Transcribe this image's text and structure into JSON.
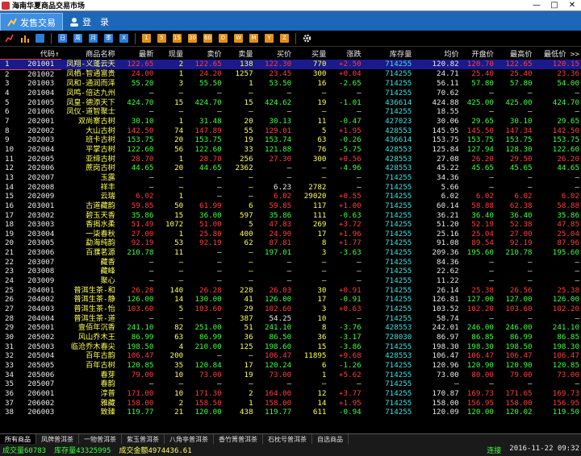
{
  "window": {
    "title": "海南华夏商品交易市场",
    "min": "—",
    "max": "□",
    "close": "✕"
  },
  "tabs": [
    {
      "label": "发售交易"
    },
    {
      "label": "登　录"
    }
  ],
  "toolbar": {
    "icons": [
      "line-chart-icon",
      "bar-chart-icon",
      "display-icon",
      "F1",
      "F2",
      "F3",
      "F4",
      "F5",
      "F6",
      "F7",
      "F8",
      "F9",
      "F10",
      "F11",
      "F12",
      "F13",
      "F14",
      "F15",
      "gear-icon"
    ]
  },
  "columns": [
    "",
    "代码↑",
    "商品名称",
    "最新",
    "现量",
    "卖价",
    "卖量",
    "买价",
    "买量",
    "涨跌",
    "库存量",
    "均价",
    "开盘价",
    "最高价",
    "最低价 >>"
  ],
  "rows": [
    [
      "1",
      "201001",
      "凤翔-义蓬云天",
      "122.65",
      "2",
      "122.65",
      "138",
      "122.30",
      "770",
      "+2.50",
      "714255",
      "120.82",
      "120.70",
      "122.65",
      "120.15"
    ],
    [
      "2",
      "201002",
      "凤栖-智通富贵",
      "24.00",
      "1",
      "24.20",
      "1257",
      "23.45",
      "300",
      "+0.04",
      "714255",
      "24.71",
      "25.40",
      "25.40",
      "23.36"
    ],
    [
      "3",
      "201003",
      "凤和-通润而泽",
      "55.20",
      "3",
      "55.50",
      "1",
      "53.50",
      "16",
      "-2.65",
      "714255",
      "56.11",
      "57.80",
      "57.80",
      "54.00"
    ],
    [
      "4",
      "201004",
      "凤鸣-倍达九州",
      "—",
      "—",
      "—",
      "—",
      "—",
      "—",
      "—",
      "714255",
      "70.62",
      "—",
      "—",
      "—"
    ],
    [
      "5",
      "201005",
      "凤皇-德添天下",
      "424.70",
      "15",
      "424.70",
      "15",
      "424.62",
      "19",
      "-1.01",
      "436614",
      "424.88",
      "425.00",
      "425.00",
      "424.70"
    ],
    [
      "6",
      "201006",
      "凤仪-道智聚士",
      "—",
      "—",
      "—",
      "—",
      "—",
      "—",
      "—",
      "714255",
      "18.55",
      "—",
      "—",
      "—"
    ],
    [
      "7",
      "202001",
      "双尚寨古树",
      "30.10",
      "1",
      "31.48",
      "20",
      "30.13",
      "11",
      "-0.47",
      "427023",
      "30.06",
      "29.65",
      "30.10",
      "29.65"
    ],
    [
      "8",
      "202002",
      "大山古树",
      "142.50",
      "74",
      "147.89",
      "55",
      "129.01",
      "5",
      "+1.95",
      "428553",
      "145.95",
      "145.50",
      "147.34",
      "142.50"
    ],
    [
      "9",
      "202003",
      "班卡古树",
      "153.75",
      "20",
      "153.75",
      "19",
      "153.74",
      "63",
      "-0.26",
      "436614",
      "153.75",
      "153.75",
      "153.75",
      "153.75"
    ],
    [
      "10",
      "202004",
      "平掌古树",
      "122.60",
      "56",
      "122.60",
      "33",
      "121.88",
      "76",
      "-5.75",
      "428553",
      "125.84",
      "127.94",
      "128.30",
      "122.60"
    ],
    [
      "11",
      "202005",
      "亚缔古树",
      "28.70",
      "1",
      "28.70",
      "256",
      "27.30",
      "300",
      "+0.56",
      "428553",
      "27.08",
      "26.20",
      "29.50",
      "26.20"
    ],
    [
      "12",
      "202006",
      "蔗岗古树",
      "44.65",
      "20",
      "44.65",
      "2362",
      "—",
      "—",
      "-4.96",
      "428553",
      "45.22",
      "45.65",
      "45.65",
      "44.65"
    ],
    [
      "13",
      "202007",
      "玉露",
      "—",
      "—",
      "—",
      "—",
      "—",
      "—",
      "—",
      "714255",
      "34.36",
      "—",
      "—",
      "—"
    ],
    [
      "14",
      "202008",
      "祥丰",
      "—",
      "—",
      "—",
      "—",
      "6.23",
      "2782",
      "—",
      "714255",
      "5.66",
      "—",
      "—",
      "—"
    ],
    [
      "15",
      "202009",
      "云瑞",
      "6.02",
      "1",
      "—",
      "—",
      "6.02",
      "29020",
      "+0.55",
      "714255",
      "6.02",
      "6.02",
      "6.02",
      "6.02"
    ],
    [
      "16",
      "203001",
      "古道藏韵",
      "59.85",
      "50",
      "61.99",
      "6",
      "59.85",
      "117",
      "+1.00",
      "714255",
      "60.14",
      "58.88",
      "62.38",
      "58.88"
    ],
    [
      "17",
      "203002",
      "碧玉天香",
      "35.86",
      "15",
      "36.00",
      "597",
      "35.86",
      "111",
      "-0.63",
      "714255",
      "36.21",
      "36.40",
      "36.40",
      "35.86"
    ],
    [
      "18",
      "203003",
      "香揭水柔",
      "51.49",
      "1072",
      "51.00",
      "5",
      "47.83",
      "269",
      "+3.72",
      "714255",
      "51.20",
      "52.19",
      "52.38",
      "47.85"
    ],
    [
      "19",
      "203004",
      "一柒春秋",
      "27.00",
      "1",
      "25.80",
      "400",
      "24.90",
      "17",
      "+1.96",
      "714255",
      "25.16",
      "25.04",
      "27.00",
      "25.04"
    ],
    [
      "20",
      "203005",
      "勐海纯韵",
      "92.19",
      "53",
      "92.19",
      "62",
      "87.81",
      "8",
      "+1.77",
      "714255",
      "91.08",
      "89.54",
      "92.19",
      "87.96"
    ],
    [
      "21",
      "203006",
      "百濮茗源",
      "210.78",
      "11",
      "—",
      "—",
      "197.01",
      "3",
      "-3.63",
      "714255",
      "209.36",
      "195.60",
      "210.78",
      "195.60"
    ],
    [
      "22",
      "203007",
      "藏香",
      "—",
      "—",
      "—",
      "—",
      "—",
      "—",
      "—",
      "714255",
      "84.36",
      "—",
      "—",
      "—"
    ],
    [
      "23",
      "203008",
      "藏峰",
      "—",
      "—",
      "—",
      "—",
      "—",
      "—",
      "—",
      "714255",
      "22.62",
      "—",
      "—",
      "—"
    ],
    [
      "24",
      "203009",
      "聚心",
      "—",
      "—",
      "—",
      "—",
      "—",
      "—",
      "—",
      "714255",
      "11.22",
      "—",
      "—",
      "—"
    ],
    [
      "25",
      "204001",
      "普洱生茶-和",
      "26.28",
      "140",
      "26.28",
      "228",
      "26.03",
      "30",
      "+0.91",
      "714255",
      "26.14",
      "25.38",
      "26.56",
      "25.38"
    ],
    [
      "26",
      "204002",
      "普洱生茶-静",
      "126.00",
      "14",
      "130.00",
      "41",
      "126.00",
      "17",
      "-0.91",
      "714255",
      "126.81",
      "127.00",
      "127.00",
      "126.00"
    ],
    [
      "27",
      "204003",
      "普洱生茶-怡",
      "103.60",
      "5",
      "103.60",
      "29",
      "102.60",
      "3",
      "+0.63",
      "714255",
      "103.52",
      "102.20",
      "103.60",
      "102.20"
    ],
    [
      "28",
      "204004",
      "普洱生茶-道",
      "—",
      "—",
      "—",
      "387",
      "54.25",
      "10",
      "—",
      "714255",
      "58.74",
      "—",
      "—",
      "—"
    ],
    [
      "29",
      "205001",
      "壹佰年沉香",
      "241.10",
      "82",
      "251.00",
      "51",
      "241.10",
      "8",
      "-3.76",
      "428553",
      "242.01",
      "246.00",
      "246.00",
      "241.10"
    ],
    [
      "30",
      "205002",
      "风山乔木王",
      "86.99",
      "63",
      "86.99",
      "36",
      "86.50",
      "36",
      "-3.17",
      "728030",
      "86.97",
      "86.85",
      "86.99",
      "86.85"
    ],
    [
      "31",
      "205003",
      "临沧乔木春尖",
      "198.50",
      "4",
      "210.00",
      "125",
      "198.60",
      "15",
      "-3.86",
      "714255",
      "198.30",
      "198.30",
      "198.50",
      "198.30"
    ],
    [
      "32",
      "205004",
      "百年古韵",
      "106.47",
      "200",
      "—",
      "—",
      "106.47",
      "11895",
      "+9.68",
      "428553",
      "106.47",
      "106.47",
      "106.47",
      "106.47"
    ],
    [
      "33",
      "205005",
      "百年古树",
      "120.85",
      "35",
      "120.84",
      "17",
      "120.24",
      "6",
      "-1.26",
      "714255",
      "120.96",
      "120.90",
      "120.90",
      "120.85"
    ],
    [
      "34",
      "205006",
      "春芽",
      "79.00",
      "10",
      "73.00",
      "19",
      "73.00",
      "1",
      "+5.62",
      "714255",
      "73.00",
      "80.00",
      "79.00",
      "73.00"
    ],
    [
      "35",
      "205007",
      "春韵",
      "—",
      "—",
      "—",
      "—",
      "—",
      "—",
      "—",
      "714255",
      "—",
      "—",
      "—",
      "—"
    ],
    [
      "36",
      "206001",
      "淳普",
      "171.00",
      "10",
      "171.30",
      "2",
      "164.00",
      "12",
      "+3.77",
      "714255",
      "170.87",
      "169.73",
      "171.65",
      "169.73"
    ],
    [
      "37",
      "206002",
      "雅藏",
      "158.00",
      "2",
      "158.50",
      "1",
      "158.00",
      "14",
      "+1.95",
      "714255",
      "158.00",
      "156.95",
      "158.00",
      "156.95"
    ],
    [
      "38",
      "206003",
      "致臻",
      "119.77",
      "21",
      "120.00",
      "438",
      "119.77",
      "611",
      "-0.94",
      "714255",
      "120.09",
      "120.00",
      "120.02",
      "119.50"
    ]
  ],
  "bottom_tabs": [
    "所有商品",
    "凤牌普洱茶",
    "一物普洱茶",
    "紫玉普洱茶",
    "八角亭普洱茶",
    "香竹箐普洱茶",
    "石枕号普洱茶",
    "自选商品"
  ],
  "status": {
    "volume": "成交量60783",
    "stock": "库存量43325995",
    "amount": "成交金额4974436.61",
    "conn": "连接",
    "time": "2016-11-22 09:32"
  }
}
